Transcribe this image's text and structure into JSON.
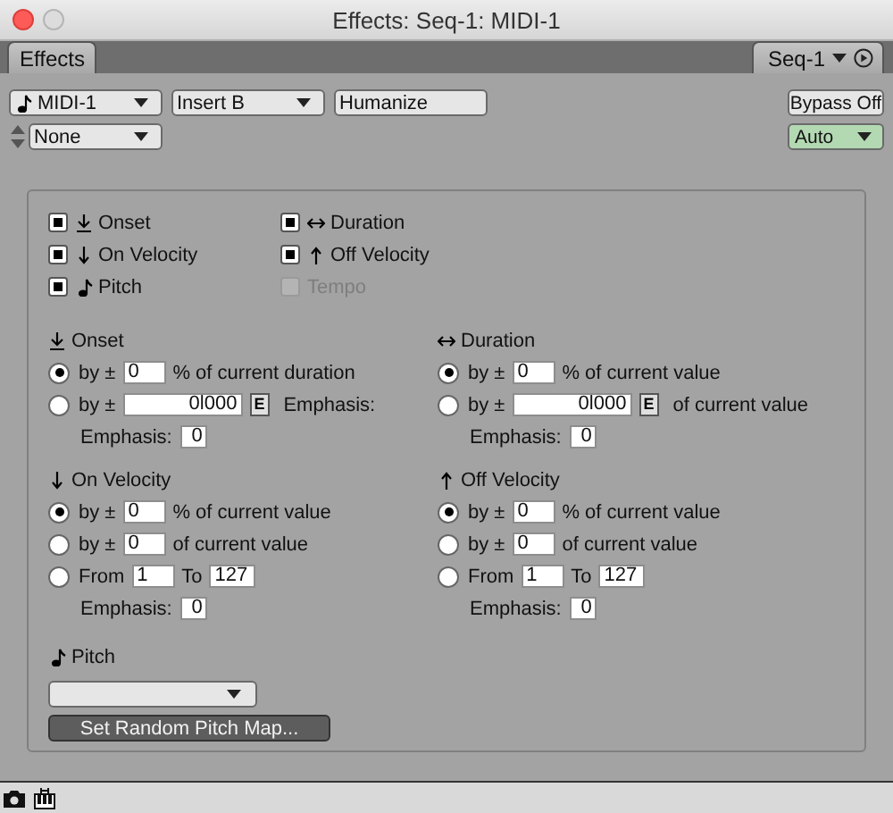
{
  "window": {
    "title": "Effects: Seq-1: MIDI-1"
  },
  "tabs": [
    {
      "label": "Effects",
      "selected": true
    }
  ],
  "seq_tab": {
    "label": "Seq-1"
  },
  "toolbar": {
    "track": "MIDI-1",
    "insert": "Insert B",
    "plugin": "Humanize",
    "bypass": "Bypass Off",
    "preset": "None",
    "automation": "Auto"
  },
  "enables": [
    {
      "label": "Onset",
      "kind": "onset",
      "checked": true,
      "disabled": false
    },
    {
      "label": "Duration",
      "kind": "duration",
      "checked": true,
      "disabled": false
    },
    {
      "label": "On Velocity",
      "kind": "on_velocity",
      "checked": true,
      "disabled": false
    },
    {
      "label": "Off Velocity",
      "kind": "off_velocity",
      "checked": true,
      "disabled": false
    },
    {
      "label": "Pitch",
      "kind": "pitch",
      "checked": true,
      "disabled": false
    },
    {
      "label": "Tempo",
      "checked": false,
      "disabled": true
    }
  ],
  "sections": [
    {
      "title": "Onset",
      "kind": "onset",
      "rows": [
        {
          "selected": true,
          "parts": [
            {
              "kind": "label",
              "text": "by ±"
            },
            {
              "kind": "field",
              "text": "0"
            },
            {
              "kind": "label",
              "text": "% of current duration"
            }
          ]
        },
        {
          "selected": false,
          "parts": [
            {
              "kind": "label",
              "text": "by ±"
            },
            {
              "kind": "wide_field",
              "text": "0l000"
            },
            {
              "kind": "e_button",
              "text": "E"
            },
            {
              "kind": "label",
              "text": "Emphasis:"
            }
          ]
        }
      ],
      "emphasis": {
        "label": "Emphasis:",
        "value": "0"
      }
    },
    {
      "title": "Duration",
      "kind": "duration",
      "rows": [
        {
          "selected": true,
          "parts": [
            {
              "kind": "label",
              "text": "by ±"
            },
            {
              "kind": "field",
              "text": "0"
            },
            {
              "kind": "label",
              "text": "% of current value"
            }
          ]
        },
        {
          "selected": false,
          "parts": [
            {
              "kind": "label",
              "text": "by ±"
            },
            {
              "kind": "wide_field",
              "text": "0l000"
            },
            {
              "kind": "e_button",
              "text": "E"
            },
            {
              "kind": "label",
              "text": "of current value"
            }
          ]
        }
      ],
      "emphasis": {
        "label": "Emphasis:",
        "value": "0"
      }
    },
    {
      "title": "On Velocity",
      "kind": "on_velocity",
      "rows": [
        {
          "selected": true,
          "parts": [
            {
              "kind": "label",
              "text": "by ±"
            },
            {
              "kind": "field",
              "text": "0"
            },
            {
              "kind": "label",
              "text": "% of current value"
            }
          ]
        },
        {
          "selected": false,
          "parts": [
            {
              "kind": "label",
              "text": "by ±"
            },
            {
              "kind": "field",
              "text": "0"
            },
            {
              "kind": "label",
              "text": "of current value"
            }
          ]
        },
        {
          "selected": false,
          "parts": [
            {
              "kind": "label",
              "text": "From"
            },
            {
              "kind": "field",
              "text": "1"
            },
            {
              "kind": "label",
              "text": "To"
            },
            {
              "kind": "field",
              "text": "127"
            }
          ]
        }
      ],
      "emphasis": {
        "label": "Emphasis:",
        "value": "0"
      }
    },
    {
      "title": "Off Velocity",
      "kind": "off_velocity",
      "rows": [
        {
          "selected": true,
          "parts": [
            {
              "kind": "label",
              "text": "by ±"
            },
            {
              "kind": "field",
              "text": "0"
            },
            {
              "kind": "label",
              "text": "% of current value"
            }
          ]
        },
        {
          "selected": false,
          "parts": [
            {
              "kind": "label",
              "text": "by ±"
            },
            {
              "kind": "field",
              "text": "0"
            },
            {
              "kind": "label",
              "text": "of current value"
            }
          ]
        },
        {
          "selected": false,
          "parts": [
            {
              "kind": "label",
              "text": "From"
            },
            {
              "kind": "field",
              "text": "1"
            },
            {
              "kind": "label",
              "text": "To"
            },
            {
              "kind": "field",
              "text": "127"
            }
          ]
        }
      ],
      "emphasis": {
        "label": "Emphasis:",
        "value": "0"
      }
    }
  ],
  "pitch": {
    "title": "Pitch",
    "kind": "pitch",
    "button": "Set Random Pitch Map..."
  }
}
